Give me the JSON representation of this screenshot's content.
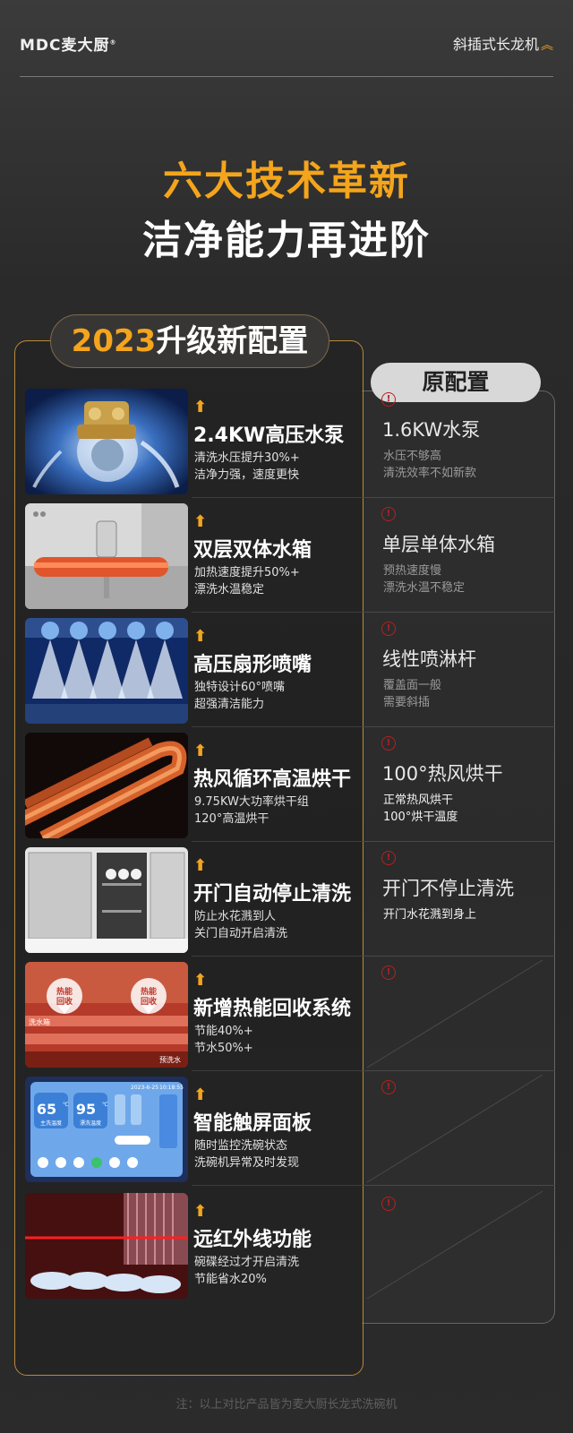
{
  "header": {
    "logo": "MDC麦大厨",
    "logo_mark": "®",
    "series": "斜插式长龙机",
    "series_icon": "double-chevron-up-icon"
  },
  "headline": {
    "line1": "六大技术革新",
    "line2": "洁净能力再进阶"
  },
  "new_config": {
    "year": "2023",
    "label": "升级新配置"
  },
  "old_config": {
    "label": "原配置"
  },
  "colors": {
    "accent": "#f4a51c",
    "warn": "#b82020"
  },
  "rows": [
    {
      "title": "2.4KW高压水泵",
      "desc1": "清洗水压提升30%+",
      "desc2": "洁净力强，速度更快",
      "old_title": "1.6KW水泵",
      "old_desc1": "水压不够高",
      "old_desc2": "清洗效率不如新款"
    },
    {
      "title": "双层双体水箱",
      "desc1": "加热速度提升50%+",
      "desc2": "漂洗水温稳定",
      "old_title": "单层单体水箱",
      "old_desc1": "预热速度慢",
      "old_desc2": "漂洗水温不稳定"
    },
    {
      "title": "高压扇形喷嘴",
      "desc1": "独特设计60°喷嘴",
      "desc2": "超强清洁能力",
      "old_title": "线性喷淋杆",
      "old_desc1": "覆盖面一般",
      "old_desc2": "需要斜插"
    },
    {
      "title": "热风循环高温烘干",
      "desc1": "9.75KW大功率烘干组",
      "desc2": "120°高温烘干",
      "old_title": "100°热风烘干",
      "old_desc1": "正常热风烘干",
      "old_desc2": "100°烘干温度"
    },
    {
      "title": "开门自动停止清洗",
      "desc1": "防止水花溅到人",
      "desc2": "关门自动开启清洗",
      "old_title": "开门不停止清洗",
      "old_desc1": "开门水花溅到身上",
      "old_desc2": ""
    },
    {
      "title": "新增热能回收系统",
      "desc1": "节能40%+",
      "desc2": "节水50%+",
      "old_title": "",
      "old_desc1": "",
      "old_desc2": ""
    },
    {
      "title": "智能触屏面板",
      "desc1": "随时监控洗碗状态",
      "desc2": "洗碗机异常及时发现",
      "old_title": "",
      "old_desc1": "",
      "old_desc2": ""
    },
    {
      "title": "远红外线功能",
      "desc1": "碗碟经过才开启清洗",
      "desc2": "节能省水20%",
      "old_title": "",
      "old_desc1": "",
      "old_desc2": ""
    }
  ],
  "thumb_labels": {
    "heat_left": "热能",
    "heat_left2": "回收",
    "heat_right": "热能",
    "heat_right2": "回收",
    "wash_tank": "洗水箱",
    "rinse_tank": "预洗水",
    "screen_date": "2023-6-25",
    "screen_time": "10:18:55",
    "screen_t1": "65",
    "screen_t1_label": "主洗温度",
    "screen_t2": "95",
    "screen_t2_label": "漂洗温度",
    "screen_unit": "℃"
  },
  "footnote": "注：以上对比产品皆为麦大厨长龙式洗碗机"
}
